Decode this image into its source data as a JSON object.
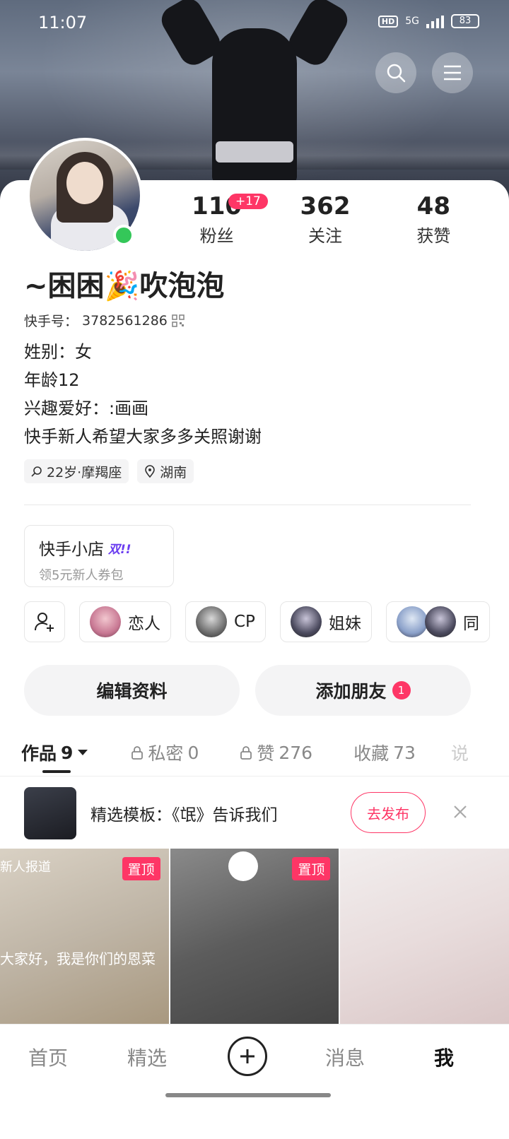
{
  "status_bar": {
    "time": "11:07",
    "network": "5G",
    "battery": "83"
  },
  "profile": {
    "stats": [
      {
        "value": "110",
        "label": "粉丝",
        "badge": "+17"
      },
      {
        "value": "362",
        "label": "关注"
      },
      {
        "value": "48",
        "label": "获赞"
      }
    ],
    "nickname": "~困困🎉吹泡泡",
    "user_id_label": "快手号：",
    "user_id": "3782561286",
    "bio": [
      "姓别：女",
      "年龄12",
      "兴趣爱好：:画画",
      "快手新人希望大家多多关照谢谢"
    ],
    "tags": [
      {
        "icon": "search-icon",
        "text": "22岁·摩羯座"
      },
      {
        "icon": "location-icon",
        "text": "湖南"
      }
    ]
  },
  "shop": {
    "title": "快手小店",
    "badge": "双!!",
    "subtitle": "领5元新人券包"
  },
  "relations": [
    {
      "label": "恋人"
    },
    {
      "label": "CP"
    },
    {
      "label": "姐妹"
    },
    {
      "label": "同"
    }
  ],
  "actions": {
    "edit": "编辑资料",
    "add_friend": "添加朋友",
    "add_friend_badge": "1"
  },
  "tabs": [
    {
      "label": "作品",
      "count": "9"
    },
    {
      "label": "私密",
      "count": "0"
    },
    {
      "label": "赞",
      "count": "276"
    },
    {
      "label": "收藏",
      "count": "73"
    },
    {
      "label": "说"
    }
  ],
  "template": {
    "text": "精选模板：《氓》告诉我们",
    "button": "去发布"
  },
  "grid": [
    {
      "pin": "置顶",
      "caption": "新人报道",
      "subtitle": "大家好，我是你们的恩菜"
    },
    {
      "pin": "置顶"
    },
    {}
  ],
  "bottom_nav": {
    "home": "首页",
    "featured": "精选",
    "messages": "消息",
    "me": "我"
  }
}
